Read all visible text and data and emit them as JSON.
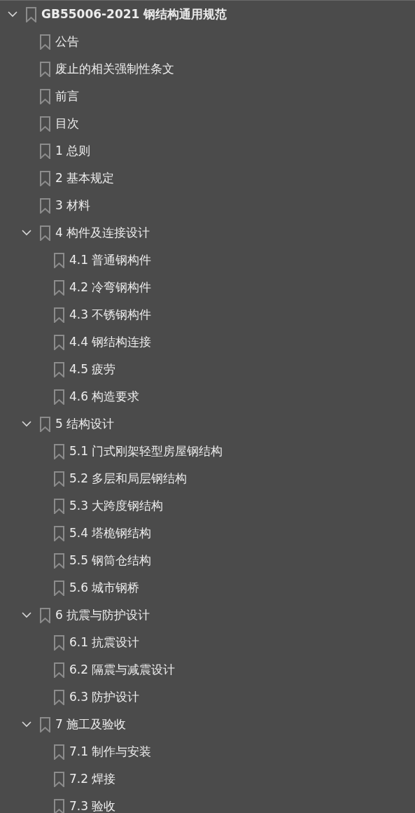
{
  "tree": [
    {
      "label": "GB55006-2021 钢结构通用规范",
      "expanded": true,
      "children": [
        {
          "label": "公告"
        },
        {
          "label": "废止的相关强制性条文"
        },
        {
          "label": "前言"
        },
        {
          "label": "目次"
        },
        {
          "label": "1 总则"
        },
        {
          "label": "2 基本规定"
        },
        {
          "label": "3 材料"
        },
        {
          "label": "4 构件及连接设计",
          "expanded": true,
          "children": [
            {
              "label": "4.1 普通钢构件"
            },
            {
              "label": "4.2 冷弯钢构件"
            },
            {
              "label": "4.3 不锈钢构件"
            },
            {
              "label": "4.4 钢结构连接"
            },
            {
              "label": "4.5 疲劳"
            },
            {
              "label": "4.6 构造要求"
            }
          ]
        },
        {
          "label": "5 结构设计",
          "expanded": true,
          "children": [
            {
              "label": "5.1 门式刚架轻型房屋钢结构"
            },
            {
              "label": "5.2 多层和局层钢结构"
            },
            {
              "label": "5.3 大跨度钢结构"
            },
            {
              "label": "5.4 塔桅钢结构"
            },
            {
              "label": "5.5 钢筒仓结构"
            },
            {
              "label": "5.6 城市钢桥"
            }
          ]
        },
        {
          "label": "6 抗震与防护设计",
          "expanded": true,
          "children": [
            {
              "label": "6.1 抗震设计"
            },
            {
              "label": "6.2 隔震与减震设计"
            },
            {
              "label": "6.3 防护设计"
            }
          ]
        },
        {
          "label": "7 施工及验收",
          "expanded": true,
          "children": [
            {
              "label": "7.1 制作与安装"
            },
            {
              "label": "7.2 焊接"
            },
            {
              "label": "7.3 验收"
            }
          ]
        }
      ]
    }
  ]
}
